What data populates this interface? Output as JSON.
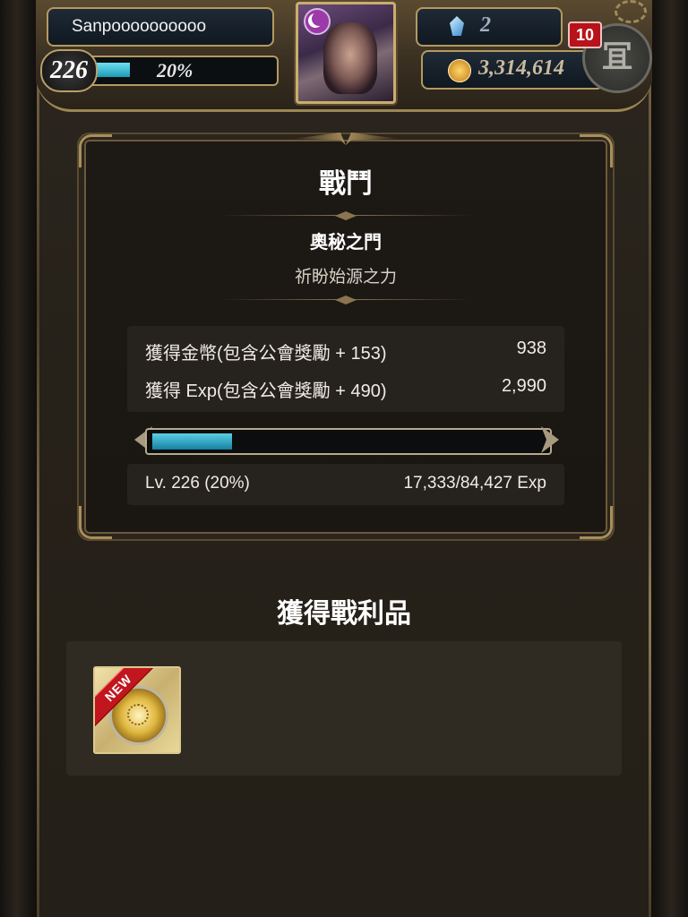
{
  "header": {
    "player_name": "Sanpoooooooooo",
    "level": "226",
    "level_progress_text": "20%",
    "level_progress": 0.2,
    "gems": "2",
    "coins": "3,314,614",
    "notification_count": "10",
    "menu_glyph": "冝"
  },
  "battle": {
    "title": "戰鬥",
    "dungeon_name": "奧秘之門",
    "dungeon_subtitle": "祈盼始源之力",
    "rewards": [
      {
        "label": "獲得金幣(包含公會獎勵 + 153)",
        "value": "938"
      },
      {
        "label": "獲得 Exp(包含公會獎勵 + 490)",
        "value": "2,990"
      }
    ],
    "exp_bar_fill": 0.205,
    "level_text": "Lv. 226 (20%)",
    "exp_text": "17,333/84,427 Exp"
  },
  "loot": {
    "title": "獲得戰利品",
    "items": [
      {
        "badge": "NEW",
        "icon": "gold-medal-icon"
      }
    ]
  },
  "colors": {
    "xp_bar": "#1e9ab4",
    "notification": "#b8121a",
    "new_ribbon": "#c2161e",
    "frame_gold": "#b49a60"
  }
}
